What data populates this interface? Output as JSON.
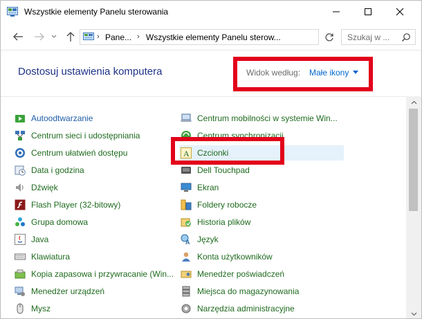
{
  "window": {
    "title": "Wszystkie elementy Panelu sterowania"
  },
  "address": {
    "crumbs": [
      "Pane...",
      "Wszystkie elementy Panelu sterow..."
    ]
  },
  "search": {
    "placeholder": "Szukaj w ..."
  },
  "header": {
    "title": "Dostosuj ustawienia komputera",
    "view_label": "Widok według:",
    "view_value": "Małe ikony"
  },
  "colors": {
    "title_blue": "#1e3287",
    "link_blue": "#0066cc",
    "highlight_red": "#e2001a",
    "selection_bg": "#e5f1fb"
  },
  "left_items": [
    {
      "label": "Autoodtwarzanie",
      "icon": "autoplay-icon"
    },
    {
      "label": "Centrum sieci i udostępniania",
      "icon": "network-icon"
    },
    {
      "label": "Centrum ułatwień dostępu",
      "icon": "accessibility-icon"
    },
    {
      "label": "Data i godzina",
      "icon": "clock-icon"
    },
    {
      "label": "Dźwięk",
      "icon": "speaker-icon"
    },
    {
      "label": "Flash Player (32-bitowy)",
      "icon": "flash-icon"
    },
    {
      "label": "Grupa domowa",
      "icon": "homegroup-icon"
    },
    {
      "label": "Java",
      "icon": "java-icon"
    },
    {
      "label": "Klawiatura",
      "icon": "keyboard-icon"
    },
    {
      "label": "Kopia zapasowa i przywracanie (Win...",
      "icon": "backup-icon"
    },
    {
      "label": "Menedżer urządzeń",
      "icon": "device-manager-icon"
    },
    {
      "label": "Mysz",
      "icon": "mouse-icon"
    }
  ],
  "right_items": [
    {
      "label": "Centrum mobilności w systemie Win...",
      "icon": "mobility-icon"
    },
    {
      "label": "Centrum synchronizacji",
      "icon": "sync-icon"
    },
    {
      "label": "Czcionki",
      "icon": "font-icon"
    },
    {
      "label": "Dell Touchpad",
      "icon": "touchpad-icon"
    },
    {
      "label": "Ekran",
      "icon": "display-icon"
    },
    {
      "label": "Foldery robocze",
      "icon": "work-folders-icon"
    },
    {
      "label": "Historia plików",
      "icon": "file-history-icon"
    },
    {
      "label": "Język",
      "icon": "language-icon"
    },
    {
      "label": "Konta użytkowników",
      "icon": "user-accounts-icon"
    },
    {
      "label": "Menedżer poświadczeń",
      "icon": "credential-icon"
    },
    {
      "label": "Miejsca do magazynowania",
      "icon": "storage-icon"
    },
    {
      "label": "Narzędzia administracyjne",
      "icon": "admin-tools-icon"
    }
  ]
}
